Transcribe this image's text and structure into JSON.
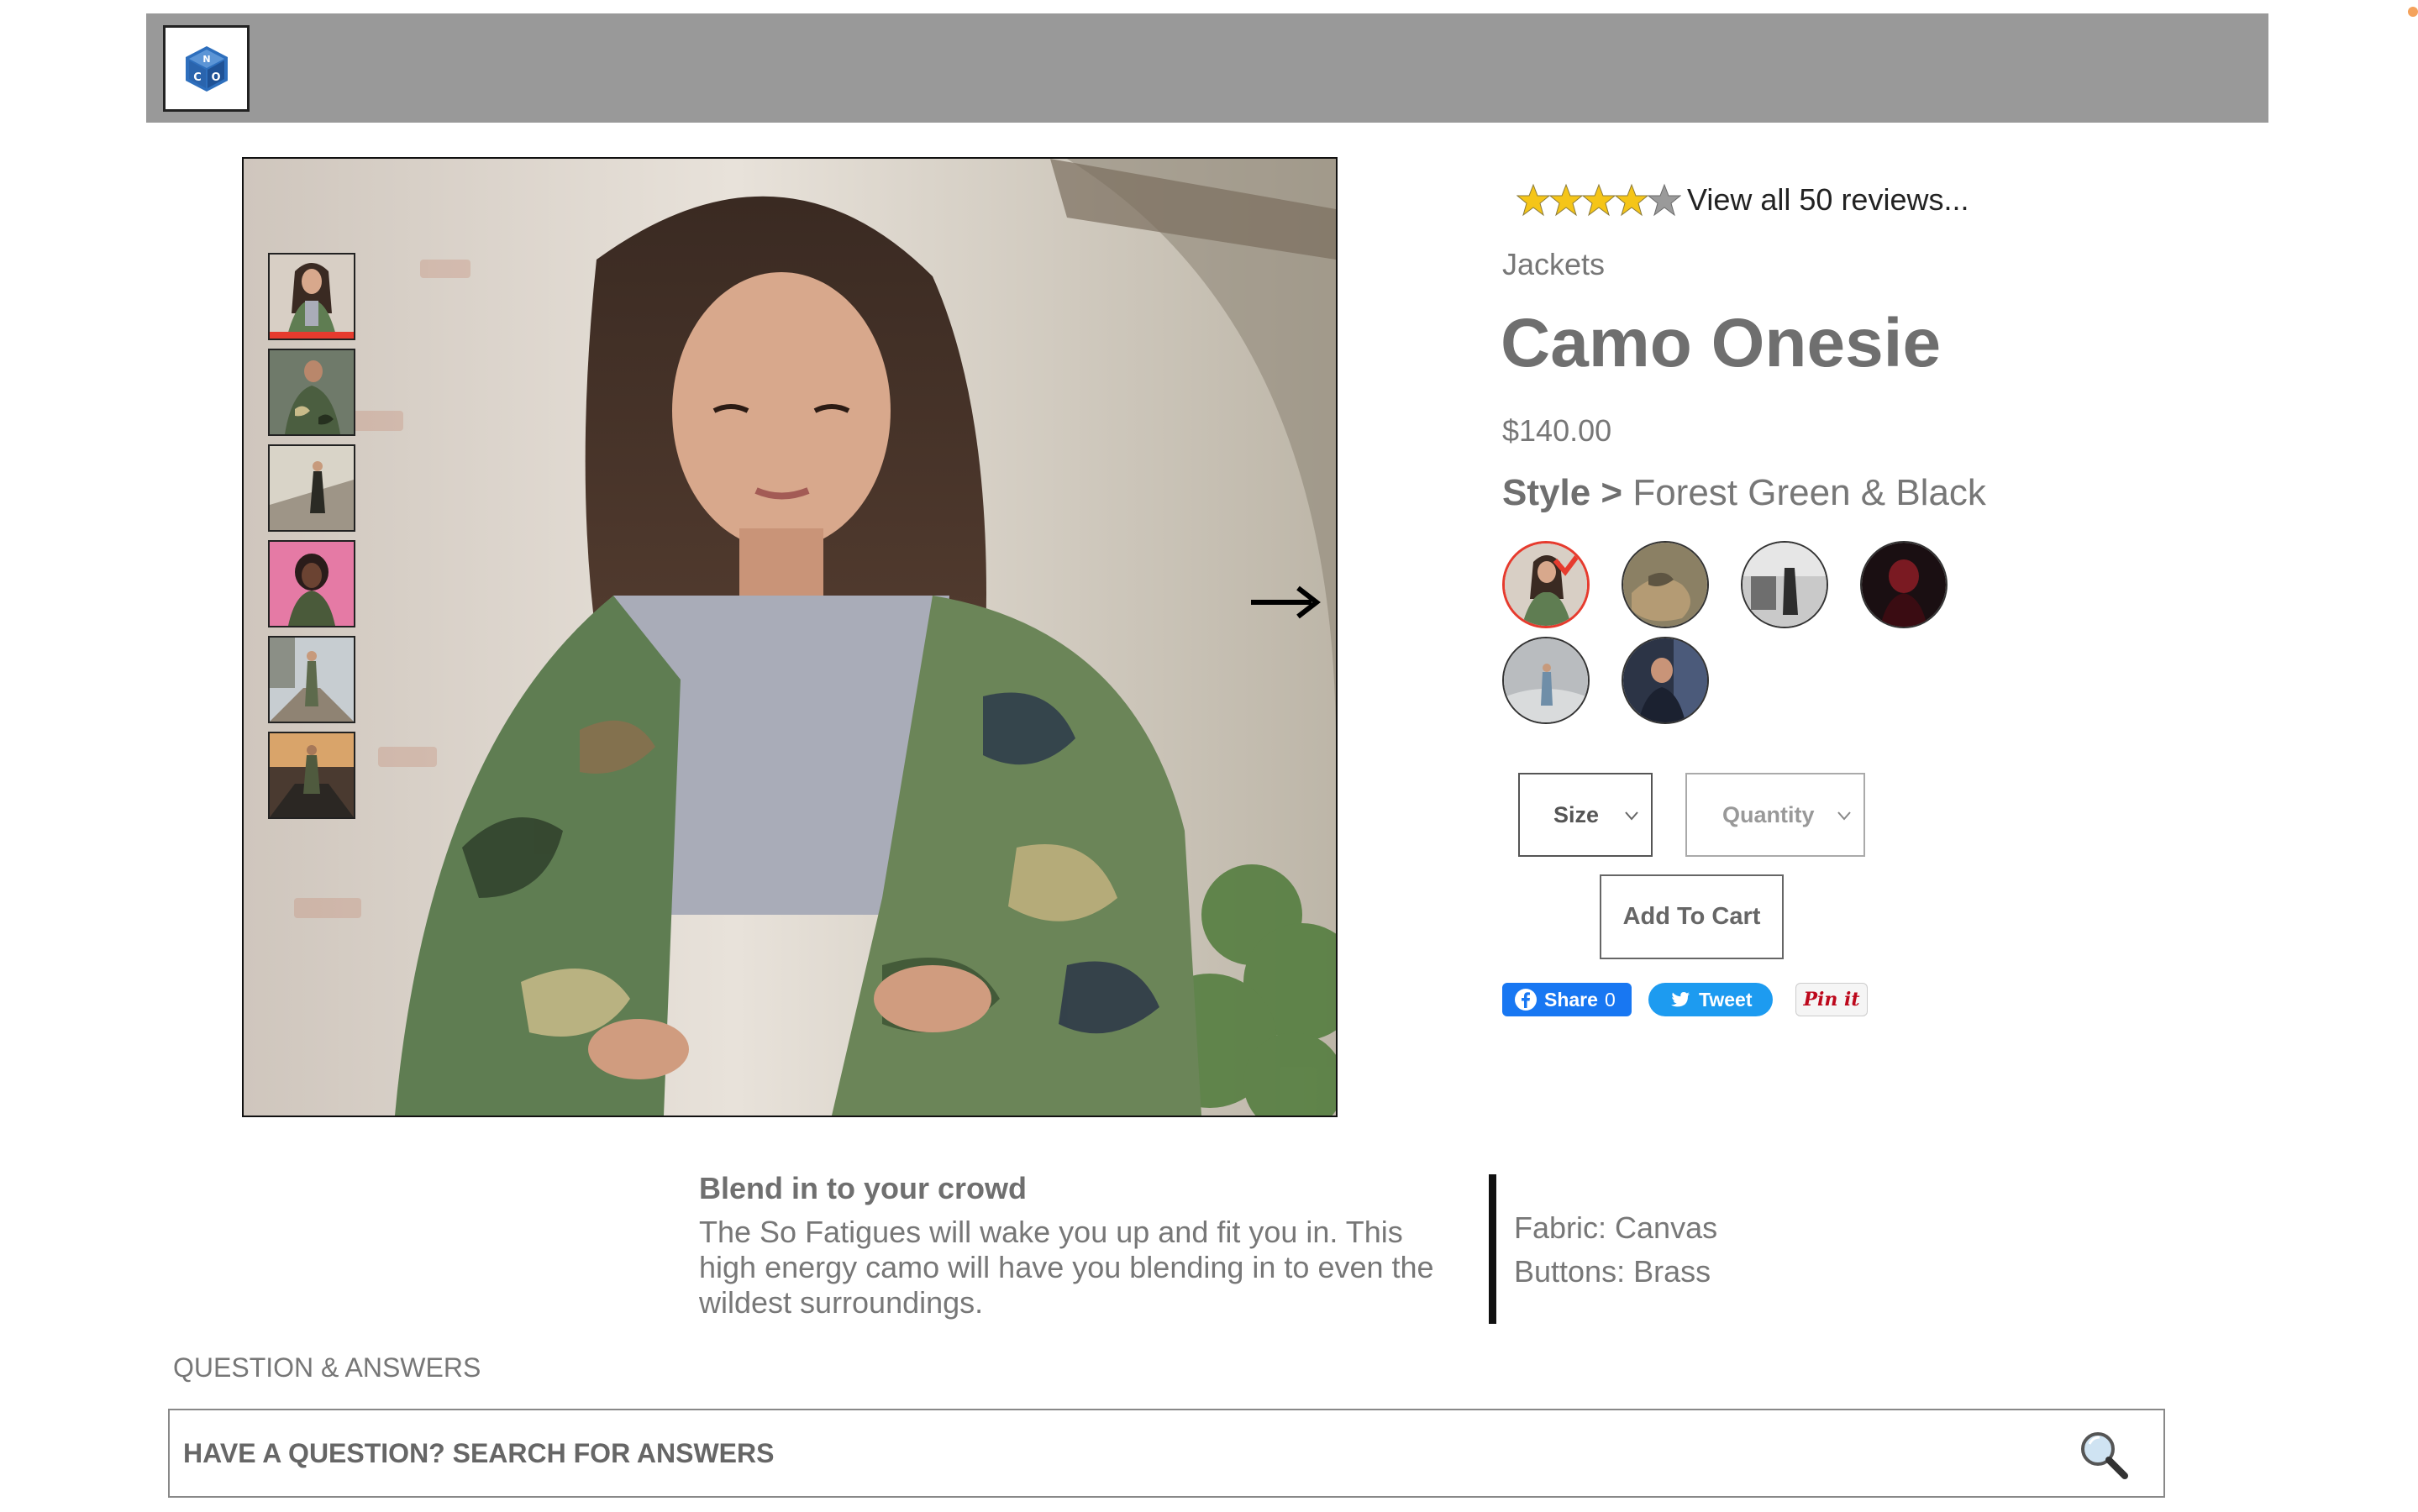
{
  "header": {
    "logo": {
      "icon": "cube-logo-icon",
      "letters": [
        "N",
        "C",
        "O"
      ]
    }
  },
  "gallery": {
    "main_image": "woman-in-camo-jacket-photo",
    "thumbnails": [
      {
        "icon": "thumb-woman-camo",
        "selected": true
      },
      {
        "icon": "thumb-man-camo",
        "selected": false
      },
      {
        "icon": "thumb-person-stairs",
        "selected": false
      },
      {
        "icon": "thumb-woman-pink-background",
        "selected": false
      },
      {
        "icon": "thumb-person-rails",
        "selected": false
      },
      {
        "icon": "thumb-person-sunset",
        "selected": false
      }
    ],
    "next_icon": "arrow-right-icon"
  },
  "product": {
    "rating": 4,
    "rating_max": 5,
    "reviews_link": "View all 50 reviews...",
    "category": "Jackets",
    "title": "Camo Onesie",
    "price": "$140.00",
    "style_label": "Style >",
    "style_value": "Forest Green & Black",
    "styles": [
      {
        "icon": "style-forest-green-black",
        "selected": true
      },
      {
        "icon": "style-desert-camo",
        "selected": false
      },
      {
        "icon": "style-urban-grey",
        "selected": false
      },
      {
        "icon": "style-red-black",
        "selected": false
      },
      {
        "icon": "style-snow-camo",
        "selected": false
      },
      {
        "icon": "style-night-blue",
        "selected": false
      }
    ],
    "size_select": "Size",
    "quantity_select": "Quantity",
    "add_to_cart": "Add To Cart",
    "share": {
      "facebook_label": "Share",
      "facebook_count": "0",
      "twitter_label": "Tweet",
      "pinterest_label": "Pin it"
    }
  },
  "description": {
    "heading": "Blend in to your crowd",
    "body": "The So Fatigues will wake you up and fit you in. This high energy camo will have you blending in to even the wildest surroundings.",
    "specs": [
      "Fabric: Canvas",
      "Buttons: Brass"
    ]
  },
  "qa": {
    "heading": "QUESTION & ANSWERS",
    "search_placeholder": "HAVE A QUESTION? SEARCH FOR ANSWERS"
  },
  "colors": {
    "header_bg": "#999999",
    "accent_red": "#e63b2e",
    "text_grey": "#777777",
    "facebook_blue": "#1877f2",
    "twitter_blue": "#1d9bf0",
    "star_gold": "#f5c518"
  }
}
